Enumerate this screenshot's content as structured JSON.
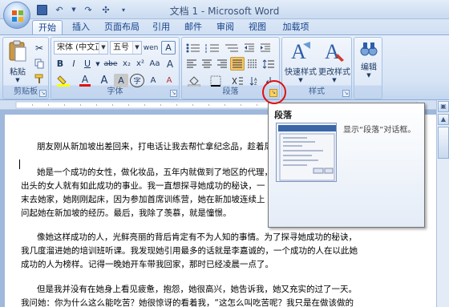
{
  "window": {
    "title": "文档 1 - Microsoft Word"
  },
  "quick_access": {
    "icons": [
      "save-icon",
      "undo-icon",
      "redo-icon",
      "touch-mode-icon",
      "customize-qat-icon"
    ]
  },
  "tabs": [
    {
      "label": "开始",
      "active": true
    },
    {
      "label": "插入"
    },
    {
      "label": "页面布局"
    },
    {
      "label": "引用"
    },
    {
      "label": "邮件"
    },
    {
      "label": "审阅"
    },
    {
      "label": "视图"
    },
    {
      "label": "加载项"
    }
  ],
  "clipboard": {
    "group_label": "剪贴板",
    "paste_label": "粘贴"
  },
  "font": {
    "group_label": "字体",
    "font_name": "宋体 (中文正)",
    "font_size": "五号",
    "bold_label": "B",
    "italic_label": "I",
    "underline_label": "U",
    "strike_label": "abe",
    "subscript_label": "x₂",
    "superscript_label": "x²",
    "aa_label": "Aa",
    "grow_label": "A",
    "shrink_label": "A",
    "clear_label": "A",
    "color_a_label": "A",
    "size_a_label": "A",
    "char_a_label": "A",
    "enclose_label": "字",
    "phonetic_label": "wen",
    "border_a_label": "A"
  },
  "paragraph": {
    "group_label": "段落"
  },
  "styles": {
    "group_label": "样式",
    "quick_styles_label": "快速样式",
    "change_styles_label": "更改样式"
  },
  "editing": {
    "label": "编辑"
  },
  "tooltip": {
    "title": "段落",
    "description": "显示“段落”对话框。"
  },
  "document": {
    "lines": [
      "朋友刚从新加坡出差回来，打电话让我去帮忙拿纪念品，趁着周末",
      "她是一个成功的女性，做化妆品，五年内就做到了地区的代理，",
      "出头的女人就有如此成功的事业。我一直想探寻她成功的秘诀，一",
      "末去她家，她刚刚起床，因为参加首席训练营，她在新加坡连续上",
      "问起她在新加坡的经历。最后，我除了羡慕，就是憧憬。",
      "像她这样成功的人，光鲜亮丽的背后肯定有不为人知的事情。为了探寻她成功的秘诀，",
      "我几度溜进她的培训班听课。我发现她引用最多的话就是李嘉诚的，一个成功的人在以此她",
      "成功的人为榜样。记得一晚她开车带我回家，那时已经凌晨一点了。",
      "但是我并没有在她身上看见疲惫，抱怨，她很高兴，她告诉我，她又充实的过了一天。",
      "我问她：你为什么这么能吃苦？她很惊讶的看着我，“这怎么叫吃苦呢？我只是在做该做的"
    ]
  }
}
